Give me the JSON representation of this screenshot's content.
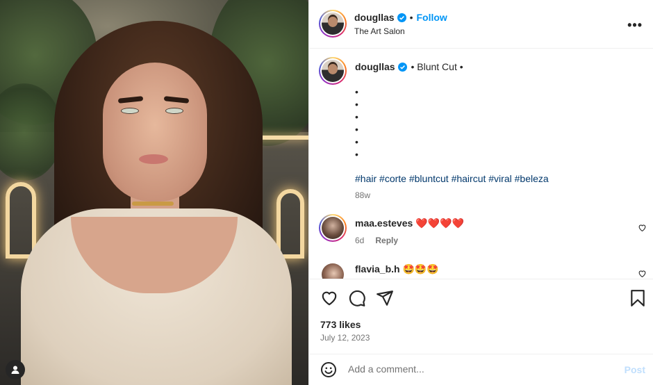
{
  "header": {
    "username": "dougllas",
    "follow_label": "Follow",
    "location": "The Art Salon",
    "more_label": "•••"
  },
  "caption": {
    "username": "dougllas",
    "text": "• Blunt Cut •",
    "bullets": [
      "•",
      "•",
      "•",
      "•",
      "•",
      "•"
    ],
    "hashtags": [
      "#hair",
      "#corte",
      "#bluntcut",
      "#haircut",
      "#viral",
      "#beleza"
    ],
    "time": "88w"
  },
  "comments": [
    {
      "username": "maa.esteves",
      "text": "❤️❤️❤️❤️",
      "time": "6d",
      "reply_label": "Reply"
    },
    {
      "username": "flavia_b.h",
      "text": "🤩🤩🤩",
      "time": "",
      "reply_label": ""
    }
  ],
  "stats": {
    "likes": "773 likes",
    "date": "July 12, 2023"
  },
  "add_comment": {
    "placeholder": "Add a comment...",
    "post_label": "Post"
  },
  "icons": [
    "heart-icon",
    "comment-icon",
    "share-icon",
    "bookmark-icon",
    "emoji-icon",
    "verified-icon",
    "user-tag-icon",
    "more-icon"
  ],
  "colors": {
    "accent": "#0095f6",
    "hashtag": "#00376b",
    "muted": "#737373",
    "post_disabled": "#c0dffd",
    "heart_red": "#ed4956"
  }
}
